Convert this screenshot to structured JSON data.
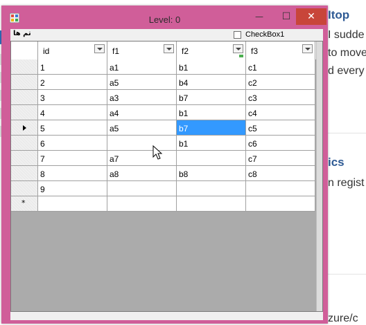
{
  "background_page": {
    "lines": [
      "Itop",
      "I sudde",
      "to move",
      "d every",
      "ics",
      "n regist",
      "zure/c"
    ]
  },
  "window": {
    "title": "Level: 0",
    "controls": {
      "minimize": "—",
      "maximize": "☐",
      "close": "✕"
    },
    "colors": {
      "frame": "#d05e99",
      "close": "#c8453a",
      "selection": "#3399ff"
    }
  },
  "menu": {
    "item": "تم ها"
  },
  "checkbox": {
    "label": "CheckBox1",
    "checked": false
  },
  "grid": {
    "columns": [
      "id",
      "f1",
      "f2",
      "f3"
    ],
    "rows": [
      [
        "1",
        "a1",
        "b1",
        "c1"
      ],
      [
        "2",
        "a5",
        "b4",
        "c2"
      ],
      [
        "3",
        "a3",
        "b7",
        "c3"
      ],
      [
        "4",
        "a4",
        "b1",
        "c4"
      ],
      [
        "5",
        "a5",
        "b7",
        "c5"
      ],
      [
        "6",
        "",
        "b1",
        "c6"
      ],
      [
        "7",
        "a7",
        "",
        "c7"
      ],
      [
        "8",
        "a8",
        "b8",
        "c8"
      ],
      [
        "9",
        "",
        "",
        ""
      ]
    ],
    "current_row": 5,
    "selected_cell": {
      "row": 5,
      "column": "f2"
    },
    "filtered_column": "f2"
  }
}
